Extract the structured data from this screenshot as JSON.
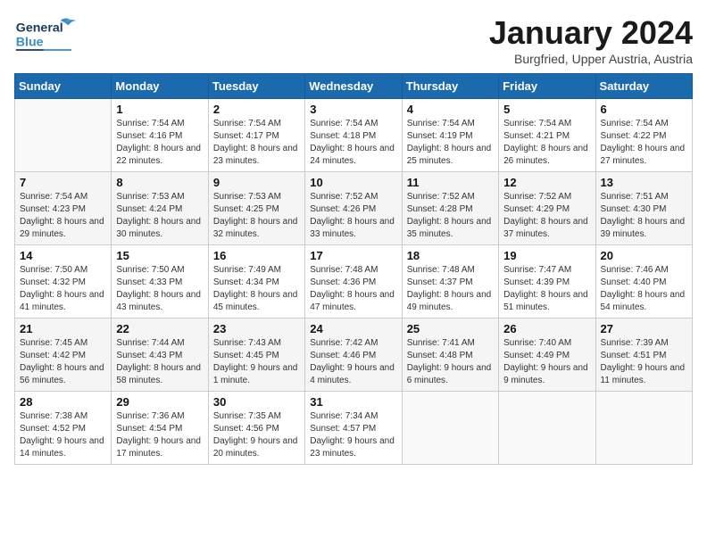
{
  "header": {
    "logo_line1": "General",
    "logo_line2": "Blue",
    "month": "January 2024",
    "location": "Burgfried, Upper Austria, Austria"
  },
  "days_of_week": [
    "Sunday",
    "Monday",
    "Tuesday",
    "Wednesday",
    "Thursday",
    "Friday",
    "Saturday"
  ],
  "weeks": [
    [
      {
        "day": "",
        "sunrise": "",
        "sunset": "",
        "daylight": ""
      },
      {
        "day": "1",
        "sunrise": "Sunrise: 7:54 AM",
        "sunset": "Sunset: 4:16 PM",
        "daylight": "Daylight: 8 hours and 22 minutes."
      },
      {
        "day": "2",
        "sunrise": "Sunrise: 7:54 AM",
        "sunset": "Sunset: 4:17 PM",
        "daylight": "Daylight: 8 hours and 23 minutes."
      },
      {
        "day": "3",
        "sunrise": "Sunrise: 7:54 AM",
        "sunset": "Sunset: 4:18 PM",
        "daylight": "Daylight: 8 hours and 24 minutes."
      },
      {
        "day": "4",
        "sunrise": "Sunrise: 7:54 AM",
        "sunset": "Sunset: 4:19 PM",
        "daylight": "Daylight: 8 hours and 25 minutes."
      },
      {
        "day": "5",
        "sunrise": "Sunrise: 7:54 AM",
        "sunset": "Sunset: 4:21 PM",
        "daylight": "Daylight: 8 hours and 26 minutes."
      },
      {
        "day": "6",
        "sunrise": "Sunrise: 7:54 AM",
        "sunset": "Sunset: 4:22 PM",
        "daylight": "Daylight: 8 hours and 27 minutes."
      }
    ],
    [
      {
        "day": "7",
        "sunrise": "Sunrise: 7:54 AM",
        "sunset": "Sunset: 4:23 PM",
        "daylight": "Daylight: 8 hours and 29 minutes."
      },
      {
        "day": "8",
        "sunrise": "Sunrise: 7:53 AM",
        "sunset": "Sunset: 4:24 PM",
        "daylight": "Daylight: 8 hours and 30 minutes."
      },
      {
        "day": "9",
        "sunrise": "Sunrise: 7:53 AM",
        "sunset": "Sunset: 4:25 PM",
        "daylight": "Daylight: 8 hours and 32 minutes."
      },
      {
        "day": "10",
        "sunrise": "Sunrise: 7:52 AM",
        "sunset": "Sunset: 4:26 PM",
        "daylight": "Daylight: 8 hours and 33 minutes."
      },
      {
        "day": "11",
        "sunrise": "Sunrise: 7:52 AM",
        "sunset": "Sunset: 4:28 PM",
        "daylight": "Daylight: 8 hours and 35 minutes."
      },
      {
        "day": "12",
        "sunrise": "Sunrise: 7:52 AM",
        "sunset": "Sunset: 4:29 PM",
        "daylight": "Daylight: 8 hours and 37 minutes."
      },
      {
        "day": "13",
        "sunrise": "Sunrise: 7:51 AM",
        "sunset": "Sunset: 4:30 PM",
        "daylight": "Daylight: 8 hours and 39 minutes."
      }
    ],
    [
      {
        "day": "14",
        "sunrise": "Sunrise: 7:50 AM",
        "sunset": "Sunset: 4:32 PM",
        "daylight": "Daylight: 8 hours and 41 minutes."
      },
      {
        "day": "15",
        "sunrise": "Sunrise: 7:50 AM",
        "sunset": "Sunset: 4:33 PM",
        "daylight": "Daylight: 8 hours and 43 minutes."
      },
      {
        "day": "16",
        "sunrise": "Sunrise: 7:49 AM",
        "sunset": "Sunset: 4:34 PM",
        "daylight": "Daylight: 8 hours and 45 minutes."
      },
      {
        "day": "17",
        "sunrise": "Sunrise: 7:48 AM",
        "sunset": "Sunset: 4:36 PM",
        "daylight": "Daylight: 8 hours and 47 minutes."
      },
      {
        "day": "18",
        "sunrise": "Sunrise: 7:48 AM",
        "sunset": "Sunset: 4:37 PM",
        "daylight": "Daylight: 8 hours and 49 minutes."
      },
      {
        "day": "19",
        "sunrise": "Sunrise: 7:47 AM",
        "sunset": "Sunset: 4:39 PM",
        "daylight": "Daylight: 8 hours and 51 minutes."
      },
      {
        "day": "20",
        "sunrise": "Sunrise: 7:46 AM",
        "sunset": "Sunset: 4:40 PM",
        "daylight": "Daylight: 8 hours and 54 minutes."
      }
    ],
    [
      {
        "day": "21",
        "sunrise": "Sunrise: 7:45 AM",
        "sunset": "Sunset: 4:42 PM",
        "daylight": "Daylight: 8 hours and 56 minutes."
      },
      {
        "day": "22",
        "sunrise": "Sunrise: 7:44 AM",
        "sunset": "Sunset: 4:43 PM",
        "daylight": "Daylight: 8 hours and 58 minutes."
      },
      {
        "day": "23",
        "sunrise": "Sunrise: 7:43 AM",
        "sunset": "Sunset: 4:45 PM",
        "daylight": "Daylight: 9 hours and 1 minute."
      },
      {
        "day": "24",
        "sunrise": "Sunrise: 7:42 AM",
        "sunset": "Sunset: 4:46 PM",
        "daylight": "Daylight: 9 hours and 4 minutes."
      },
      {
        "day": "25",
        "sunrise": "Sunrise: 7:41 AM",
        "sunset": "Sunset: 4:48 PM",
        "daylight": "Daylight: 9 hours and 6 minutes."
      },
      {
        "day": "26",
        "sunrise": "Sunrise: 7:40 AM",
        "sunset": "Sunset: 4:49 PM",
        "daylight": "Daylight: 9 hours and 9 minutes."
      },
      {
        "day": "27",
        "sunrise": "Sunrise: 7:39 AM",
        "sunset": "Sunset: 4:51 PM",
        "daylight": "Daylight: 9 hours and 11 minutes."
      }
    ],
    [
      {
        "day": "28",
        "sunrise": "Sunrise: 7:38 AM",
        "sunset": "Sunset: 4:52 PM",
        "daylight": "Daylight: 9 hours and 14 minutes."
      },
      {
        "day": "29",
        "sunrise": "Sunrise: 7:36 AM",
        "sunset": "Sunset: 4:54 PM",
        "daylight": "Daylight: 9 hours and 17 minutes."
      },
      {
        "day": "30",
        "sunrise": "Sunrise: 7:35 AM",
        "sunset": "Sunset: 4:56 PM",
        "daylight": "Daylight: 9 hours and 20 minutes."
      },
      {
        "day": "31",
        "sunrise": "Sunrise: 7:34 AM",
        "sunset": "Sunset: 4:57 PM",
        "daylight": "Daylight: 9 hours and 23 minutes."
      },
      {
        "day": "",
        "sunrise": "",
        "sunset": "",
        "daylight": ""
      },
      {
        "day": "",
        "sunrise": "",
        "sunset": "",
        "daylight": ""
      },
      {
        "day": "",
        "sunrise": "",
        "sunset": "",
        "daylight": ""
      }
    ]
  ]
}
